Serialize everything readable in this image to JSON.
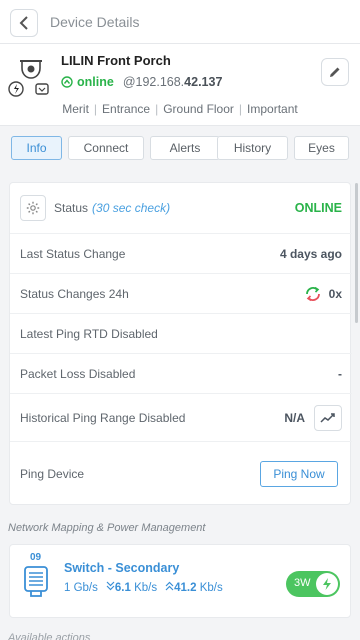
{
  "topbar": {
    "title": "Device Details"
  },
  "device": {
    "name": "LILIN Front Porch",
    "status": "online",
    "ip_prefix": "@192.168.",
    "ip_suffix": "42.137",
    "tags": [
      "Merit",
      "Entrance",
      "Ground Floor",
      "Important"
    ]
  },
  "tabs": [
    {
      "label": "Info",
      "active": true
    },
    {
      "label": "Connect",
      "active": false
    },
    {
      "label": "Alerts",
      "active": false
    },
    {
      "label": "History",
      "active": false
    },
    {
      "label": "Eyes",
      "active": false
    }
  ],
  "info": {
    "status_label": "Status",
    "status_hint": "(30 sec check)",
    "status_value": "ONLINE",
    "last_change_label": "Last Status Change",
    "last_change_value": "4 days ago",
    "changes_label": "Status Changes 24h",
    "changes_value": "0x",
    "rtd_label": "Latest Ping RTD Disabled",
    "loss_label": "Packet Loss Disabled",
    "loss_value": "-",
    "range_label": "Historical Ping Range Disabled",
    "range_value": "N/A",
    "ping_label": "Ping Device",
    "ping_button": "Ping Now"
  },
  "network": {
    "section_title": "Network Mapping & Power Management",
    "switch_port": "09",
    "switch_name": "Switch - Secondary",
    "link_speed": "1 Gb/s",
    "down_rate": "6.1",
    "down_unit": "Kb/s",
    "up_rate": "41.2",
    "up_unit": "Kb/s",
    "power": "3W"
  },
  "next_section": "Available actions",
  "colors": {
    "accent": "#3a8fd6",
    "online": "#2ab34a",
    "power": "#4cc560"
  }
}
